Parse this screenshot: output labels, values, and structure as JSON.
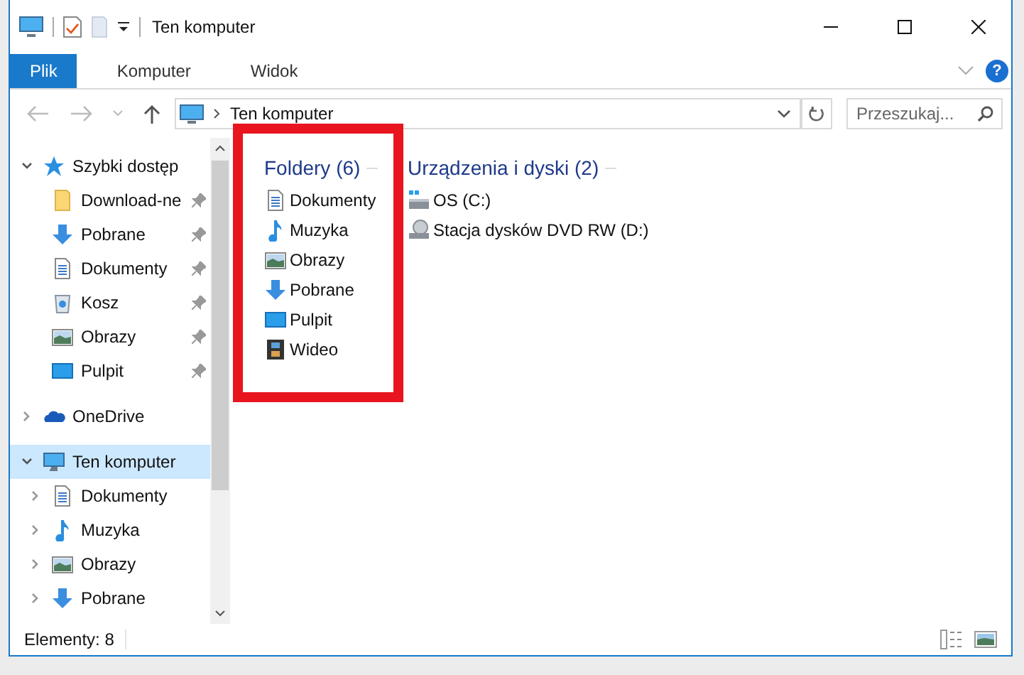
{
  "window": {
    "title": "Ten komputer"
  },
  "ribbon": {
    "tabs": [
      {
        "label": "Plik",
        "selected": true
      },
      {
        "label": "Komputer",
        "selected": false
      },
      {
        "label": "Widok",
        "selected": false
      }
    ],
    "help": "?"
  },
  "address": {
    "path": "Ten komputer"
  },
  "search": {
    "placeholder": "Przeszukaj..."
  },
  "sidebar": {
    "items": [
      {
        "label": "Szybki dostęp",
        "kind": "star",
        "expanded": true,
        "selected": false,
        "children": [
          {
            "label": "Download-ne",
            "kind": "folder",
            "pinned": true
          },
          {
            "label": "Pobrane",
            "kind": "downloads",
            "pinned": true
          },
          {
            "label": "Dokumenty",
            "kind": "documents",
            "pinned": true
          },
          {
            "label": "Kosz",
            "kind": "recycle",
            "pinned": true
          },
          {
            "label": "Obrazy",
            "kind": "pictures",
            "pinned": true
          },
          {
            "label": "Pulpit",
            "kind": "desktop",
            "pinned": true
          }
        ]
      },
      {
        "label": "OneDrive",
        "kind": "cloud",
        "expanded": false,
        "selected": false
      },
      {
        "label": "Ten komputer",
        "kind": "computer",
        "expanded": true,
        "selected": true,
        "children": [
          {
            "label": "Dokumenty",
            "kind": "documents",
            "expanded": false
          },
          {
            "label": "Muzyka",
            "kind": "music",
            "expanded": false
          },
          {
            "label": "Obrazy",
            "kind": "pictures",
            "expanded": false
          },
          {
            "label": "Pobrane",
            "kind": "downloads",
            "expanded": false
          }
        ]
      }
    ]
  },
  "groups": [
    {
      "title": "Foldery (6)",
      "items": [
        {
          "label": "Dokumenty",
          "kind": "documents"
        },
        {
          "label": "Muzyka",
          "kind": "music"
        },
        {
          "label": "Obrazy",
          "kind": "pictures"
        },
        {
          "label": "Pobrane",
          "kind": "downloads"
        },
        {
          "label": "Pulpit",
          "kind": "desktop"
        },
        {
          "label": "Wideo",
          "kind": "videos"
        }
      ]
    },
    {
      "title": "Urządzenia i dyski (2)",
      "items": [
        {
          "label": "OS (C:)",
          "kind": "drive"
        },
        {
          "label": "Stacja dysków DVD RW (D:)",
          "kind": "dvd"
        }
      ]
    }
  ],
  "highlight_frame": true,
  "status_bar": {
    "count": "Elementy: 8"
  }
}
